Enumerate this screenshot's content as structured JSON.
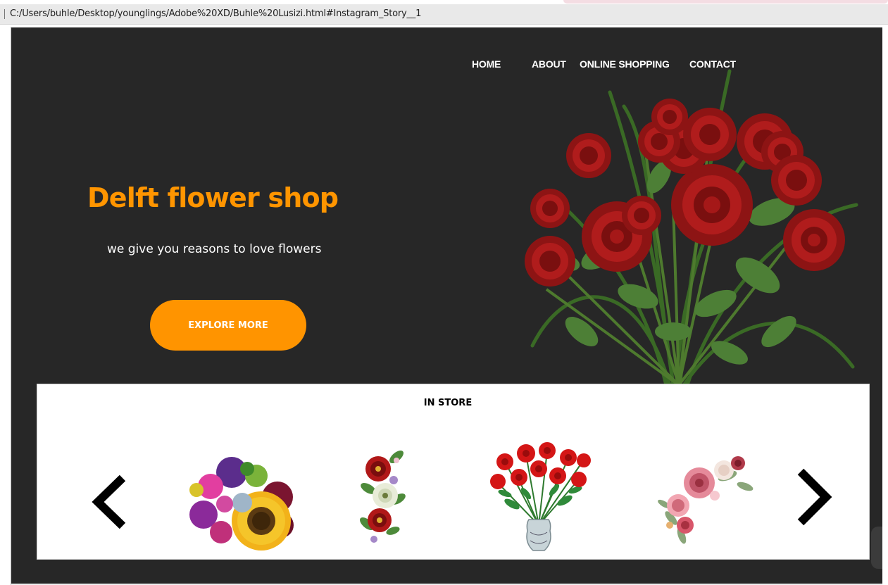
{
  "browser": {
    "address": "C:/Users/buhle/Desktop/younglings/Adobe%20XD/Buhle%20Lusizi.html#Instagram_Story__1"
  },
  "nav": {
    "items": [
      "HOME",
      "ABOUT",
      "ONLINE SHOPPING",
      "CONTACT"
    ]
  },
  "hero": {
    "title": "Delft flower shop",
    "subtitle": "we give you reasons to love flowers",
    "cta_label": "EXPLORE MORE",
    "accent_color": "#ff9400",
    "background_color": "#272727",
    "image": "red-rose-bouquet"
  },
  "store": {
    "title": "IN STORE",
    "prev_icon": "chevron-left-icon",
    "next_icon": "chevron-right-icon",
    "items": [
      {
        "image": "mixed-sunflower-bouquet"
      },
      {
        "image": "peony-garland"
      },
      {
        "image": "red-roses-vase"
      },
      {
        "image": "pink-rose-spray"
      }
    ]
  }
}
